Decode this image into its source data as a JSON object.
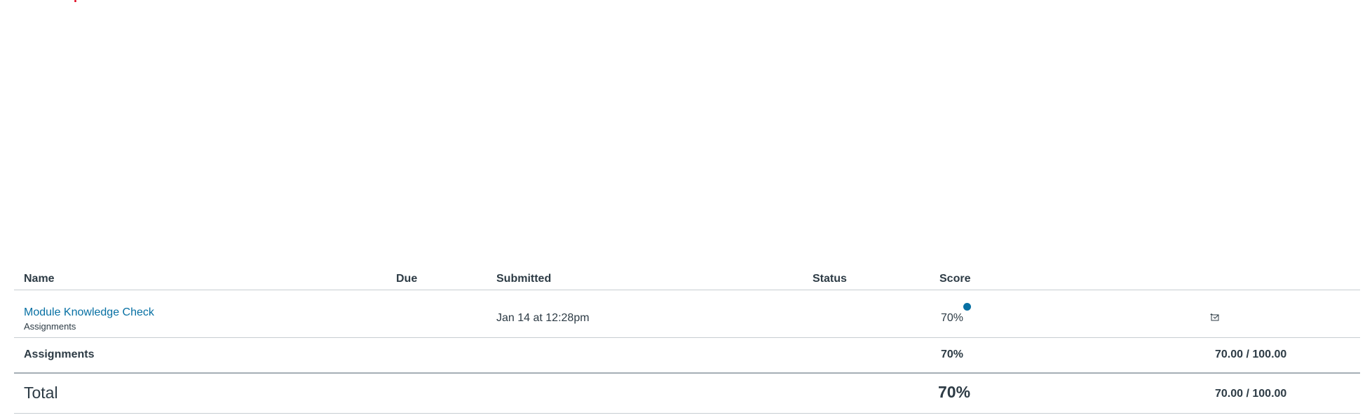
{
  "table": {
    "headers": {
      "name": "Name",
      "due": "Due",
      "submitted": "Submitted",
      "status": "Status",
      "score": "Score"
    },
    "assignments": [
      {
        "name": "Module Knowledge Check",
        "group": "Assignments",
        "due": "",
        "submitted": "Jan 14 at 12:28pm",
        "status": "",
        "score": "70%",
        "icon": "what-if-score-icon"
      }
    ],
    "group_summary": {
      "name": "Assignments",
      "score": "70%",
      "points": "70.00 / 100.00"
    },
    "total": {
      "label": "Total",
      "score": "70%",
      "points": "70.00 / 100.00"
    }
  },
  "colors": {
    "link": "#0770a3",
    "text": "#2d3b45",
    "unread_dot": "#0770a3",
    "red_mark": "#e0061f"
  }
}
